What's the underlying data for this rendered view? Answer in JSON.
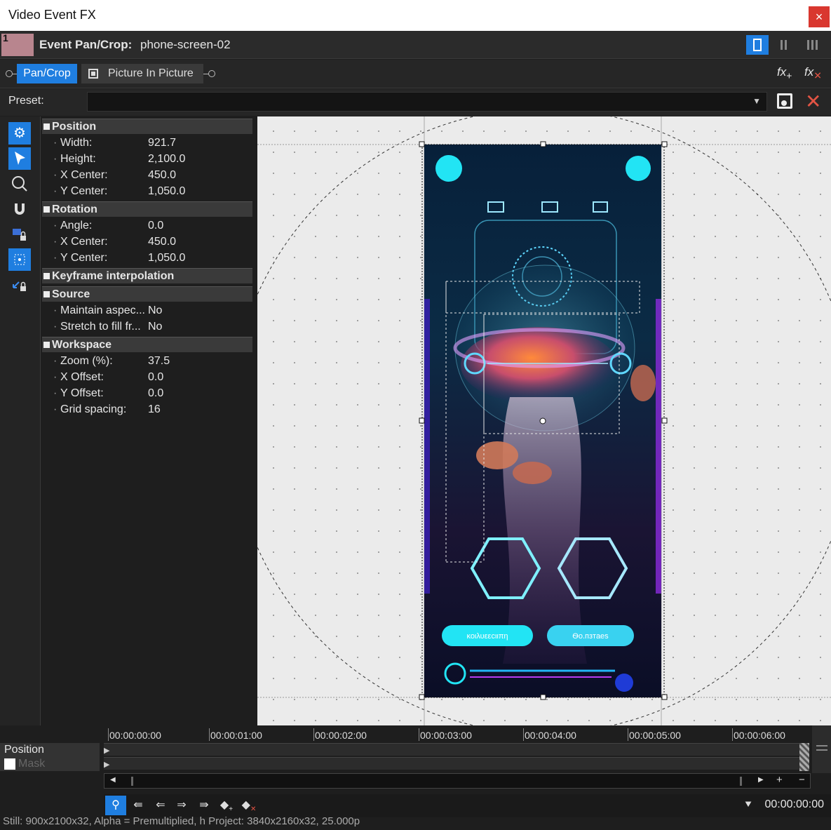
{
  "window": {
    "title": "Video Event FX",
    "close_label": "×"
  },
  "header": {
    "thumb_number": "1",
    "label": "Event Pan/Crop:",
    "value": "phone-screen-02"
  },
  "chain": {
    "pan_crop": "Pan/Crop",
    "picture_in_picture": "Picture In Picture",
    "fx_add": "fx",
    "fx_remove": "fx"
  },
  "preset": {
    "label": "Preset:",
    "value": ""
  },
  "properties": {
    "position": {
      "title": "Position",
      "rows": [
        {
          "key": "Width:",
          "value": "921.7"
        },
        {
          "key": "Height:",
          "value": "2,100.0"
        },
        {
          "key": "X Center:",
          "value": "450.0"
        },
        {
          "key": "Y Center:",
          "value": "1,050.0"
        }
      ]
    },
    "rotation": {
      "title": "Rotation",
      "rows": [
        {
          "key": "Angle:",
          "value": "0.0"
        },
        {
          "key": "X Center:",
          "value": "450.0"
        },
        {
          "key": "Y Center:",
          "value": "1,050.0"
        }
      ]
    },
    "keyframe": {
      "title": "Keyframe interpolation"
    },
    "source": {
      "title": "Source",
      "rows": [
        {
          "key": "Maintain aspec...",
          "value": "No"
        },
        {
          "key": "Stretch to fill fr...",
          "value": "No"
        }
      ]
    },
    "workspace": {
      "title": "Workspace",
      "rows": [
        {
          "key": "Zoom (%):",
          "value": "37.5"
        },
        {
          "key": "X Offset:",
          "value": "0.0"
        },
        {
          "key": "Y Offset:",
          "value": "0.0"
        },
        {
          "key": "Grid spacing:",
          "value": "16"
        }
      ]
    }
  },
  "phone": {
    "button_left": "κοιλυεεсιιπη",
    "button_right": "Ѳо.пзтаеs"
  },
  "timeline": {
    "ticks": [
      "00:00:00:00",
      "00:00:01:00",
      "00:00:02:00",
      "00:00:03:00",
      "00:00:04:00",
      "00:00:05:00",
      "00:00:06:00"
    ],
    "tracks": [
      "Position",
      "Mask"
    ],
    "timecode": "00:00:00:00",
    "zoom_in": "+",
    "zoom_out": "−"
  },
  "status": {
    "text": "Still: 900x2100x32, Alpha = Premultiplied, h   Project: 3840x2160x32, 25.000p"
  },
  "colors": {
    "accent": "#1f7ee0",
    "close": "#d9372f",
    "delete": "#e25444",
    "cyan": "#22e4f4"
  }
}
